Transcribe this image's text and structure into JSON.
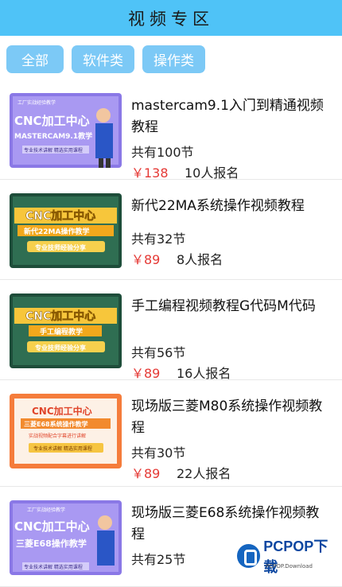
{
  "header": {
    "title": "视频专区"
  },
  "tabs": [
    {
      "label": "全部"
    },
    {
      "label": "软件类"
    },
    {
      "label": "操作类"
    }
  ],
  "courses": [
    {
      "title": "mastercam9.1入门到精通视频教程",
      "lessons": "共有100节",
      "price": "￥138",
      "enroll": "10人报名",
      "thumb": {
        "top": "工厂实战经验教学",
        "line1": "CNC加工中心",
        "line2": "MASTERCAM9.1教学",
        "foot": "专业技术讲解 精选实用课程",
        "theme": "purple"
      }
    },
    {
      "title": "新代22MA系统操作视频教程",
      "lessons": "共有32节",
      "price": "￥89",
      "enroll": "8人报名",
      "thumb": {
        "line1": "CNC加工中心",
        "line2": "新代22MA操作教学",
        "foot": "专业技师经验分享",
        "theme": "green"
      }
    },
    {
      "title": "手工编程视频教程G代码M代码",
      "lessons": "共有56节",
      "price": "￥89",
      "enroll": "16人报名",
      "thumb": {
        "line1": "CNC加工中心",
        "line2": "手工编程教学",
        "foot": "专业技师经验分享",
        "theme": "green"
      }
    },
    {
      "title": "现场版三菱M80系统操作视频教程",
      "lessons": "共有30节",
      "price": "￥89",
      "enroll": "22人报名",
      "thumb": {
        "line1": "CNC加工中心",
        "line2": "三菱E68系统操作教学",
        "sub": "实战视频配合字幕进行讲解",
        "foot": "专业技术讲解 精选实用课程",
        "theme": "orange"
      }
    },
    {
      "title": "现场版三菱E68系统操作视频教程",
      "lessons": "共有25节",
      "price": "",
      "enroll": "",
      "thumb": {
        "top": "工厂实战经验教学",
        "line1": "CNC加工中心",
        "line2": "三菱E68操作教学",
        "foot": "专业技术讲解 精选实用课程",
        "theme": "purple"
      }
    }
  ],
  "watermark": {
    "name": "PCPOP下载",
    "sub": "PCPOP.Download"
  }
}
